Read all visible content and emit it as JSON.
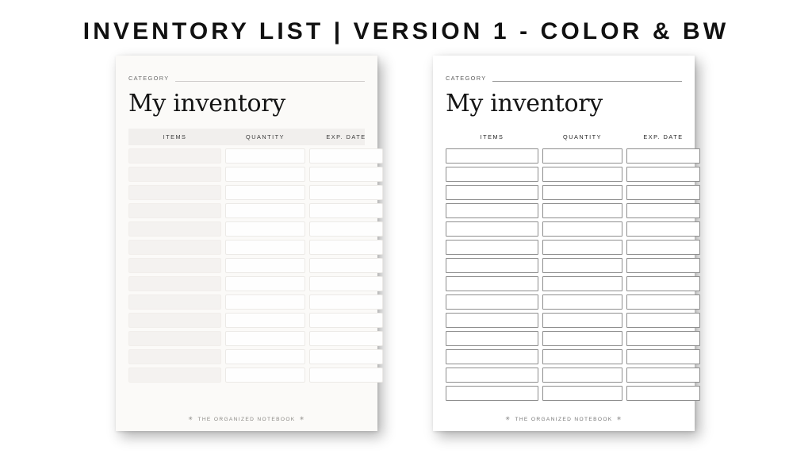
{
  "page": {
    "title": "INVENTORY LIST | VERSION 1 - COLOR & BW",
    "background_color": "#ffffff",
    "title_color": "#111111"
  },
  "cards": [
    {
      "variant": "color",
      "category_label": "CATEGORY",
      "heading": "My inventory",
      "columns": [
        "ITEMS",
        "QUANTITY",
        "EXP. DATE"
      ],
      "row_count": 13,
      "footer": {
        "text": "THE ORGANIZED NOTEBOOK",
        "left_icon": "✳",
        "right_icon": "✳"
      },
      "colors": {
        "paper": "#fbfaf8",
        "header_band": "#f1efed",
        "items_cell": "#f4f2f0",
        "plain_cell": "#fefefe",
        "cell_border": "#eceae7",
        "rule": "#cfcccb",
        "heading_text": "#141414",
        "label_text": "#6d6d6d",
        "footer_text": "#8a8884"
      }
    },
    {
      "variant": "bw",
      "category_label": "CATEGORY",
      "heading": "My inventory",
      "columns": [
        "ITEMS",
        "QUANTITY",
        "EXP. DATE"
      ],
      "row_count": 14,
      "footer": {
        "text": "THE ORGANIZED NOTEBOOK",
        "left_icon": "✳",
        "right_icon": "✳"
      },
      "colors": {
        "paper": "#ffffff",
        "header_band": "transparent",
        "items_cell": "#ffffff",
        "plain_cell": "#ffffff",
        "cell_border": "#8e8e8e",
        "rule": "#9a9a9a",
        "heading_text": "#141414",
        "label_text": "#5e5e5e",
        "footer_text": "#767676"
      }
    }
  ]
}
